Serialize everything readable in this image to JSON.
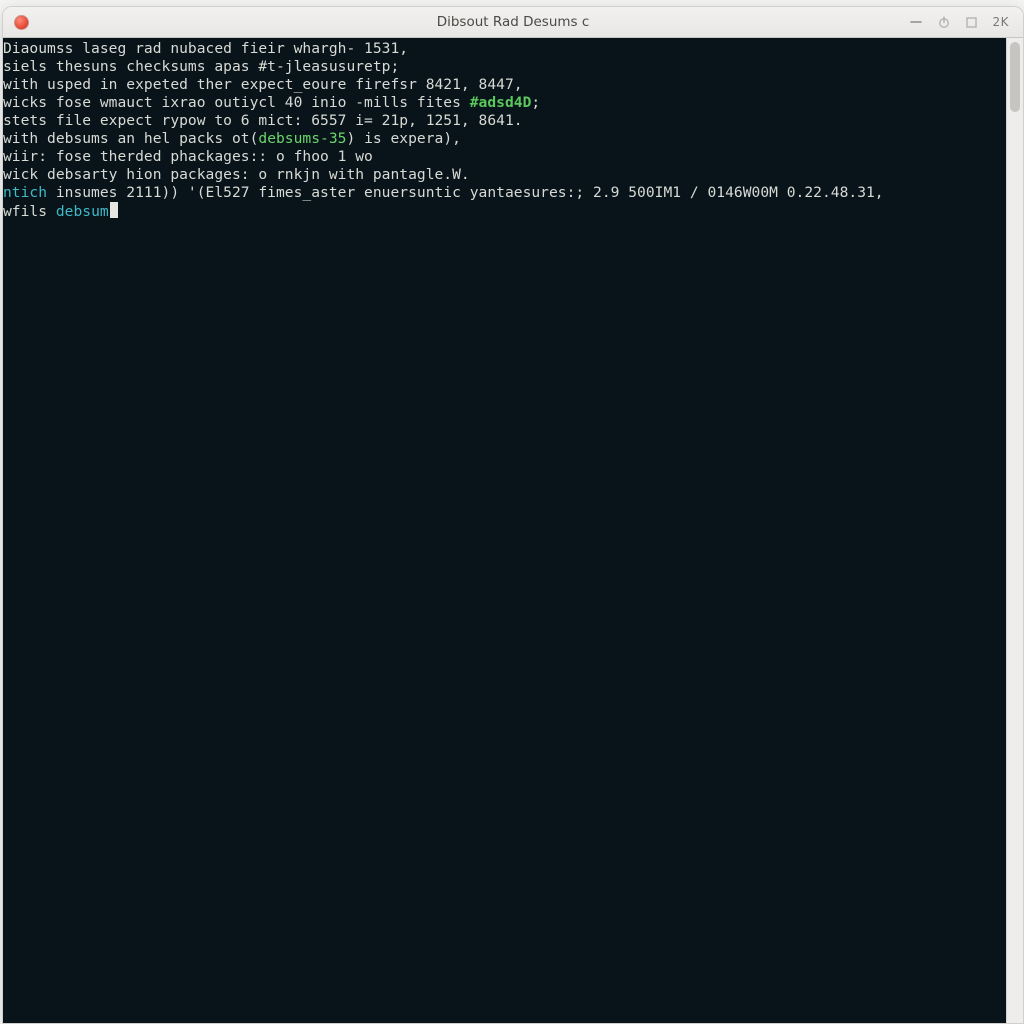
{
  "window": {
    "title": "Dibsout Rad Desums c",
    "right_label": "2K"
  },
  "terminal": {
    "lines": [
      [
        {
          "t": "Diaoumss laseg rad nubaced fieir whargh- 1531,"
        }
      ],
      [
        {
          "t": "siels thesuns checksums apas #t-jleasusuretp;"
        }
      ],
      [
        {
          "t": ""
        }
      ],
      [
        {
          "t": "with usped in expeted ther expect_eoure firefsr 8421, 8447,"
        }
      ],
      [
        {
          "t": "wicks fose wmauct ixrao outiycl 40 inio -mills fites "
        },
        {
          "t": "#adsd4D",
          "cls": "gd"
        },
        {
          "t": ";"
        }
      ],
      [
        {
          "t": "stets file expect rypow to 6 mict: 6557 i= 21p, 1251, 8641."
        }
      ],
      [
        {
          "t": ""
        }
      ],
      [
        {
          "t": "with debsums an hel packs ot("
        },
        {
          "t": "debsums-35",
          "cls": "gr"
        },
        {
          "t": ") is expera),"
        }
      ],
      [
        {
          "t": "wiir: fose therded phackages:: o fhoo 1 wo"
        }
      ],
      [
        {
          "t": "wick debsarty hion packages: o rnkjn with pantagle.W."
        }
      ],
      [
        {
          "t": ""
        }
      ],
      [
        {
          "t": "ntich",
          "cls": "cy"
        },
        {
          "t": " insumes 2111)) '(El527 fimes_aster enuersuntic yantaesures:; 2.9 500IM1 / 0146W00M 0.22.48.31,"
        }
      ],
      [
        {
          "t": "wfils ",
          "cls": ""
        },
        {
          "t": "debsum",
          "cls": "cy"
        },
        {
          "cursor": true
        }
      ]
    ]
  }
}
